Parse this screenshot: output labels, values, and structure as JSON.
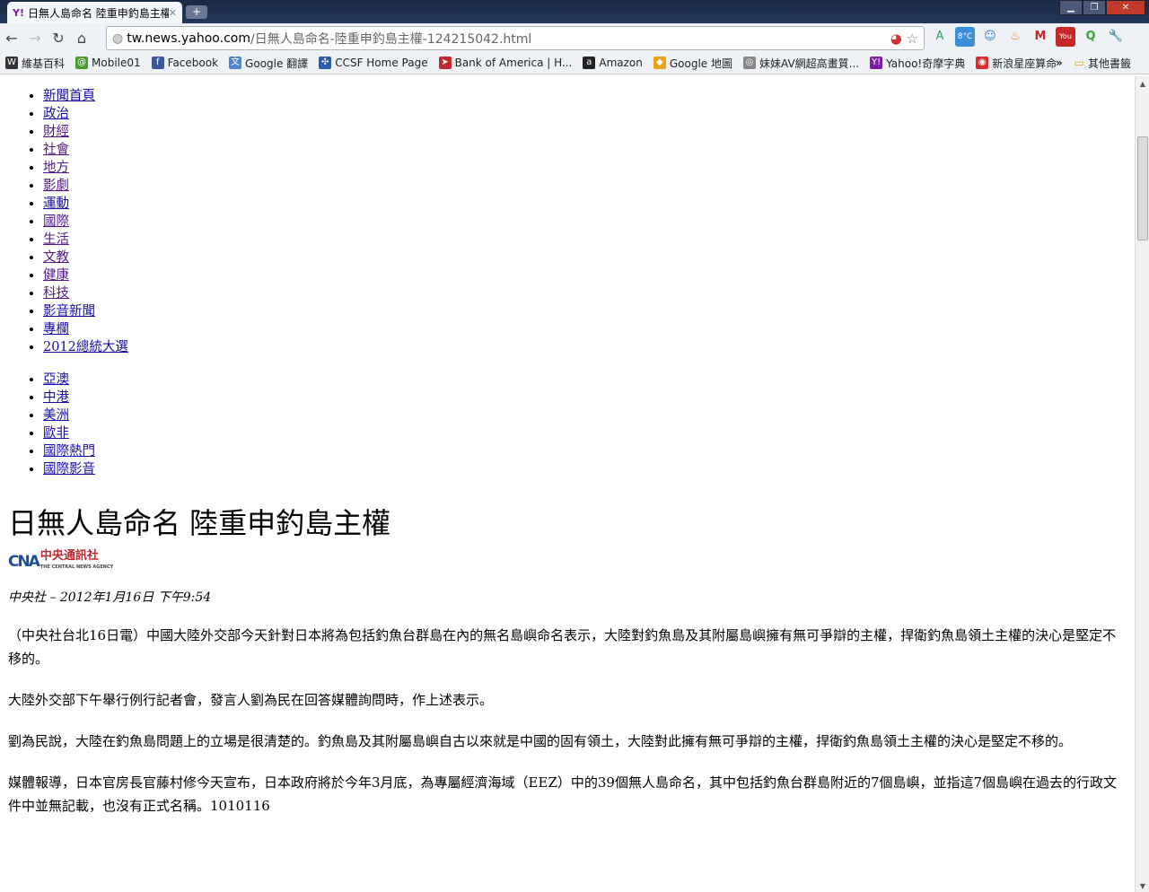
{
  "browser": {
    "tab_title": "日無人島命名 陸重申釣島主權",
    "url_host": "tw.news.yahoo.com",
    "url_path": "/日無人島命名-陸重申釣島主權-124215042.html",
    "bookmarks": [
      {
        "label": "維基百科",
        "icon": "W",
        "color": "#333"
      },
      {
        "label": "Mobile01",
        "icon": "@",
        "color": "#4a9c2f"
      },
      {
        "label": "Facebook",
        "icon": "f",
        "color": "#3b5998"
      },
      {
        "label": "Google 翻譯",
        "icon": "文",
        "color": "#4a86c8"
      },
      {
        "label": "CCSF Home Page",
        "icon": "✣",
        "color": "#2a5ca8"
      },
      {
        "label": "Bank of America | H...",
        "icon": "➤",
        "color": "#c0282d"
      },
      {
        "label": "Amazon",
        "icon": "a",
        "color": "#222"
      },
      {
        "label": "Google 地圖",
        "icon": "◆",
        "color": "#e8a317"
      },
      {
        "label": "妹妹AV網超高畫質...",
        "icon": "◎",
        "color": "#888"
      },
      {
        "label": "Yahoo!奇摩字典",
        "icon": "Y!",
        "color": "#7b1fa2"
      },
      {
        "label": "新浪星座算命",
        "icon": "◉",
        "color": "#d32f2f"
      }
    ],
    "overflow": "»",
    "other_bookmarks": "其他書籤"
  },
  "nav": {
    "primary": [
      "新聞首頁",
      "政治",
      "財經",
      "社會",
      "地方",
      "影劇",
      "運動",
      "國際",
      "生活",
      "文教",
      "健康",
      "科技",
      "影音新聞",
      "專欄",
      "2012總統大選"
    ],
    "secondary": [
      "亞澳",
      "中港",
      "美洲",
      "歐非",
      "國際熱門",
      "國際影音"
    ]
  },
  "article": {
    "title": "日無人島命名 陸重申釣島主權",
    "source_logo": "中央通訊社",
    "source_logo_en": "THE CENTRAL NEWS AGENCY",
    "byline": "中央社 – 2012年1月16日 下午9:54",
    "paragraphs": [
      "（中央社台北16日電）中國大陸外交部今天針對日本將為包括釣魚台群島在內的無名島嶼命名表示，大陸對釣魚島及其附屬島嶼擁有無可爭辯的主權，捍衛釣魚島領土主權的決心是堅定不移的。",
      "大陸外交部下午舉行例行記者會，發言人劉為民在回答媒體詢問時，作上述表示。",
      "劉為民說，大陸在釣魚島問題上的立場是很清楚的。釣魚島及其附屬島嶼自古以來就是中國的固有領土，大陸對此擁有無可爭辯的主權，捍衛釣魚島領土主權的決心是堅定不移的。",
      "媒體報導，日本官房長官藤村修今天宣布，日本政府將於今年3月底，為專屬經濟海域（EEZ）中的39個無人島命名，其中包括釣魚台群島附近的7個島嶼，並指這7個島嶼在過去的行政文件中並無記載，也沒有正式名稱。1010116"
    ]
  }
}
